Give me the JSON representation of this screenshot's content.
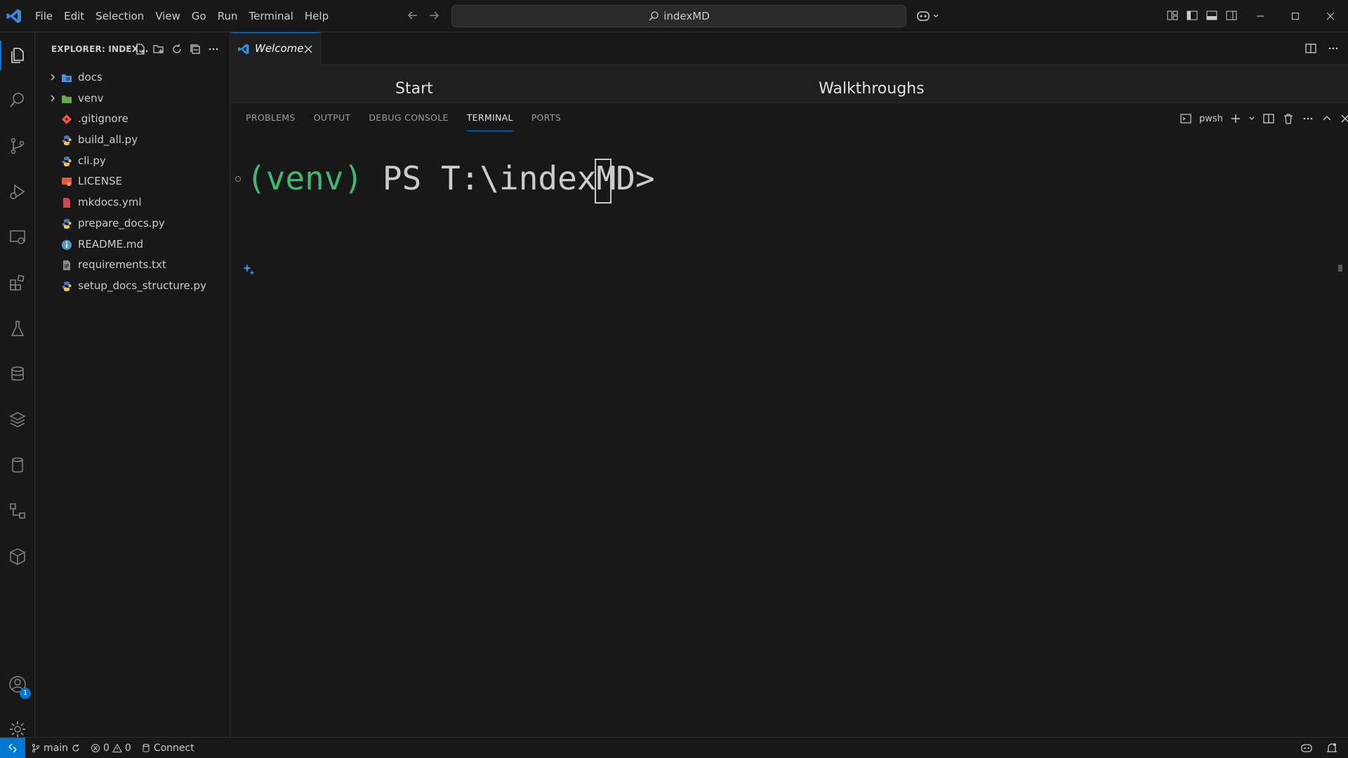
{
  "titlebar": {
    "menu": [
      "File",
      "Edit",
      "Selection",
      "View",
      "Go",
      "Run",
      "Terminal",
      "Help"
    ],
    "command_center_text": "indexMD"
  },
  "sidebar": {
    "title": "EXPLORER: INDEX...",
    "items": [
      {
        "name": "docs",
        "kind": "folder",
        "icon": "docs-folder-icon",
        "color": "#4f8fd6"
      },
      {
        "name": "venv",
        "kind": "folder",
        "icon": "venv-folder-icon",
        "color": "#6aa84f"
      },
      {
        "name": ".gitignore",
        "kind": "file",
        "icon": "git-icon",
        "color": "#e5583b"
      },
      {
        "name": "build_all.py",
        "kind": "file",
        "icon": "python-icon",
        "color": "#3d7bbd"
      },
      {
        "name": "cli.py",
        "kind": "file",
        "icon": "python-icon",
        "color": "#3d7bbd"
      },
      {
        "name": "LICENSE",
        "kind": "file",
        "icon": "license-icon",
        "color": "#e5583b"
      },
      {
        "name": "mkdocs.yml",
        "kind": "file",
        "icon": "yaml-icon",
        "color": "#d0484f"
      },
      {
        "name": "prepare_docs.py",
        "kind": "file",
        "icon": "python-icon",
        "color": "#3d7bbd"
      },
      {
        "name": "README.md",
        "kind": "file",
        "icon": "info-icon",
        "color": "#519aba"
      },
      {
        "name": "requirements.txt",
        "kind": "file",
        "icon": "text-file-icon",
        "color": "#8b8b8b"
      },
      {
        "name": "setup_docs_structure.py",
        "kind": "file",
        "icon": "python-icon",
        "color": "#3d7bbd"
      }
    ]
  },
  "editor": {
    "tab_label": "Welcome",
    "welcome_start": "Start",
    "welcome_walkthroughs": "Walkthroughs"
  },
  "panel": {
    "tabs": [
      "PROBLEMS",
      "OUTPUT",
      "DEBUG CONSOLE",
      "TERMINAL",
      "PORTS"
    ],
    "active_tab": "TERMINAL",
    "shell_label": "pwsh",
    "prompt_env": "(venv)",
    "prompt_path": " PS T:\\indexMD>"
  },
  "statusbar": {
    "branch": "main",
    "errors": "0",
    "warnings": "0",
    "connect": "Connect"
  },
  "accounts_badge": "1",
  "colors": {
    "accent": "#0078d4",
    "venv_green": "#3fb96e",
    "background": "#1f1f1f",
    "chrome": "#181818"
  }
}
